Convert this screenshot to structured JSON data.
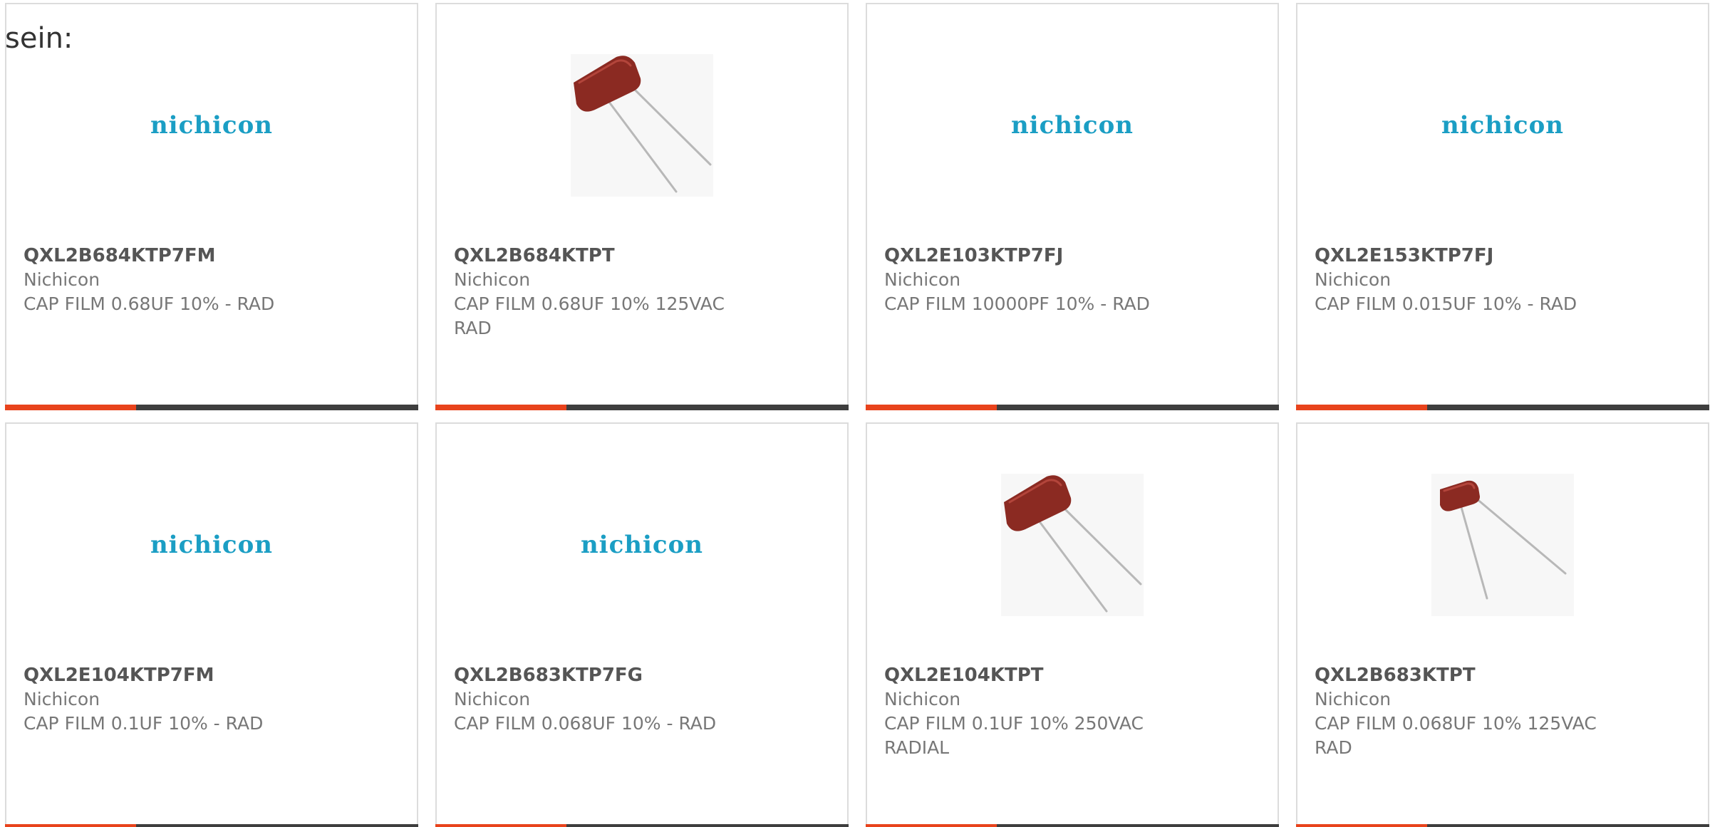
{
  "intro_text": "sein:",
  "colors": {
    "accent": "#e8431c",
    "bar": "#3e3e3e",
    "logo": "#1b9ec4",
    "capacitor": "#8b2a22"
  },
  "products": [
    {
      "part_number": "QXL2B684KTP7FM",
      "manufacturer": "Nichicon",
      "description": "CAP FILM 0.68UF 10% - RAD",
      "image": "nichicon-logo",
      "logo_text": "nichicon"
    },
    {
      "part_number": "QXL2B684KTPT",
      "manufacturer": "Nichicon",
      "description": "CAP FILM 0.68UF 10% 125VAC RAD",
      "image": "film-capacitor-photo",
      "logo_text": ""
    },
    {
      "part_number": "QXL2E103KTP7FJ",
      "manufacturer": "Nichicon",
      "description": "CAP FILM 10000PF 10% - RAD",
      "image": "nichicon-logo",
      "logo_text": "nichicon"
    },
    {
      "part_number": "QXL2E153KTP7FJ",
      "manufacturer": "Nichicon",
      "description": "CAP FILM 0.015UF 10% - RAD",
      "image": "nichicon-logo",
      "logo_text": "nichicon"
    },
    {
      "part_number": "QXL2E104KTP7FM",
      "manufacturer": "Nichicon",
      "description": "CAP FILM 0.1UF 10% - RAD",
      "image": "nichicon-logo",
      "logo_text": "nichicon"
    },
    {
      "part_number": "QXL2B683KTP7FG",
      "manufacturer": "Nichicon",
      "description": "CAP FILM 0.068UF 10% - RAD",
      "image": "nichicon-logo",
      "logo_text": "nichicon"
    },
    {
      "part_number": "QXL2E104KTPT",
      "manufacturer": "Nichicon",
      "description": "CAP FILM 0.1UF 10% 250VAC RADIAL",
      "image": "film-capacitor-photo",
      "logo_text": ""
    },
    {
      "part_number": "QXL2B683KTPT",
      "manufacturer": "Nichicon",
      "description": "CAP FILM 0.068UF 10% 125VAC RAD",
      "image": "small-film-capacitor-photo",
      "logo_text": ""
    }
  ]
}
